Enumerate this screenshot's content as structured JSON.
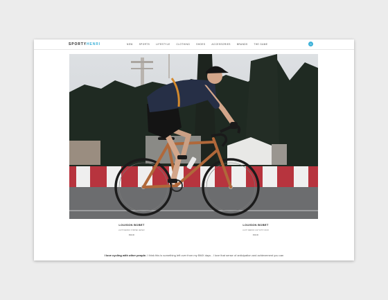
{
  "brand": {
    "part1": "SPORTY",
    "part2": "HENRI",
    "accent_color": "#3ab0d8"
  },
  "nav": {
    "items": [
      "NEW",
      "SPORTS",
      "LIFESTYLE",
      "CLOTHING",
      "SHOES",
      "ACCESSORIES",
      "BRANDS",
      "THE GAME"
    ]
  },
  "cart": {
    "count": "0",
    "icon": "cart-badge-icon"
  },
  "hero": {
    "subject": "cyclist-on-track-bike-photo"
  },
  "products": [
    {
      "name": "LOUISON BOBET",
      "desc": "LIGHT MERINO STRIPED JERSEY",
      "price": "€99,00"
    },
    {
      "name": "LOUISON BOBET",
      "desc": "LIGHT MERINO CAP WITH VISOR",
      "price": "€39,00"
    }
  ],
  "quote": {
    "bold": "I love cycling with other people.",
    "text": " I think this is something left over from my BMX days - I love that sense of anticipation and achievement you can"
  }
}
